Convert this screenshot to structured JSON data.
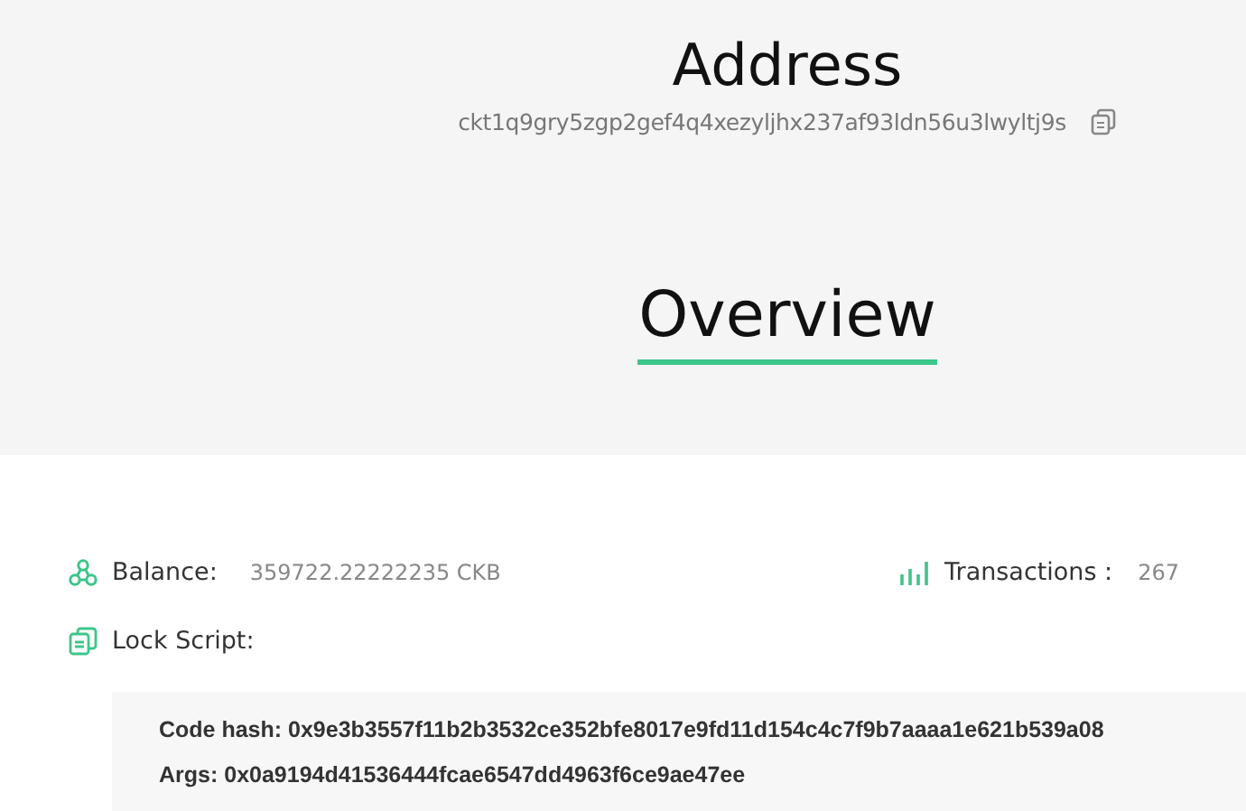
{
  "address": {
    "title": "Address",
    "hash": "ckt1q9gry5zgp2gef4q4xezyljhx237af93ldn56u3lwyltj9s"
  },
  "overview": {
    "title": "Overview"
  },
  "balance": {
    "label": "Balance:",
    "value": "359722.22222235 CKB"
  },
  "transactions": {
    "label": "Transactions :",
    "value": "267"
  },
  "lock_script": {
    "label": "Lock Script:",
    "code_hash": "Code hash: 0x9e3b3557f11b2b3532ce352bfe8017e9fd11d154c4c7f9b7aaaa1e621b539a08",
    "args": "Args: 0x0a9194d41536444fcae6547dd4963f6ce9ae47ee"
  }
}
